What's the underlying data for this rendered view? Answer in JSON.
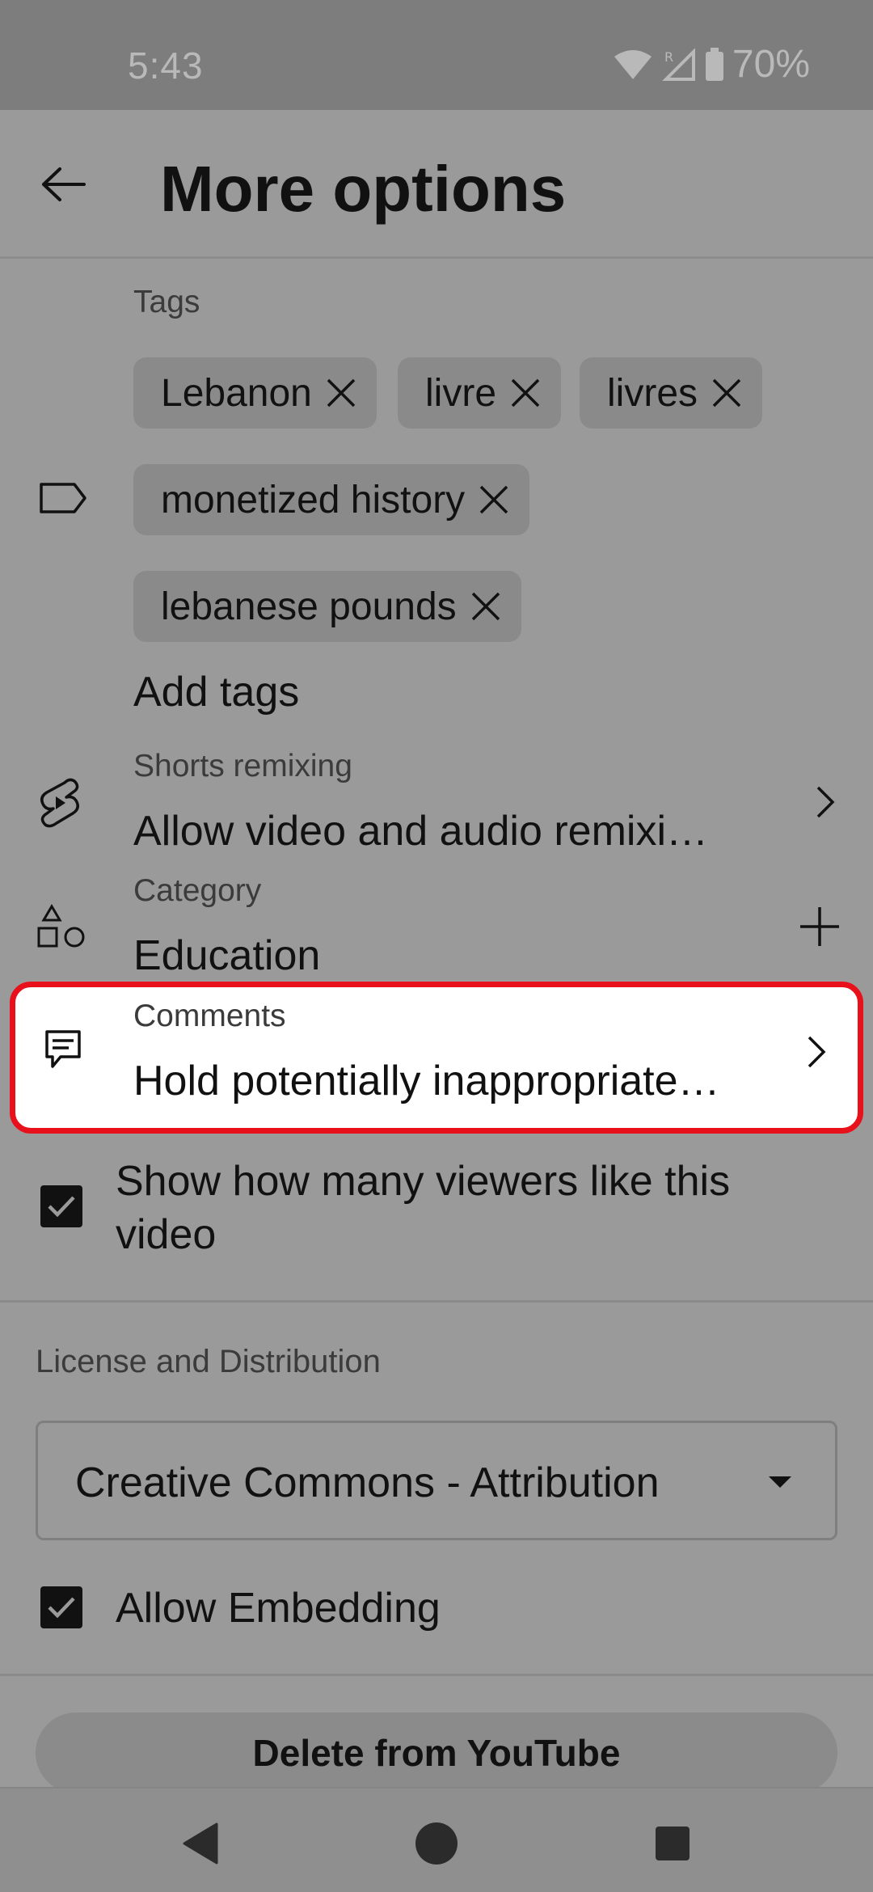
{
  "status_bar": {
    "time": "5:43",
    "battery": "70%",
    "roaming_indicator": "R",
    "icons": [
      "wifi-icon",
      "signal-icon",
      "battery-icon"
    ]
  },
  "header": {
    "title": "More options",
    "back_icon": "arrow-left-icon"
  },
  "tags": {
    "label": "Tags",
    "chips": [
      "Lebanon",
      "livre",
      "livres",
      "monetized history",
      "lebanese pounds"
    ],
    "add_label": "Add tags"
  },
  "shorts_remixing": {
    "label": "Shorts remixing",
    "value": "Allow video and audio remixi…"
  },
  "category": {
    "label": "Category",
    "value": "Education"
  },
  "comments": {
    "label": "Comments",
    "value": "Hold potentially inappropriate…"
  },
  "show_likes": {
    "line1": "Show how many viewers like this",
    "line2": "video",
    "checked": true
  },
  "license": {
    "section_label": "License and Distribution",
    "selected": "Creative Commons - Attribution"
  },
  "embedding": {
    "label": "Allow Embedding",
    "checked": true
  },
  "delete_button": "Delete from YouTube",
  "colors": {
    "highlight_border": "#e8101a",
    "overlay": "#9a9a9a"
  }
}
